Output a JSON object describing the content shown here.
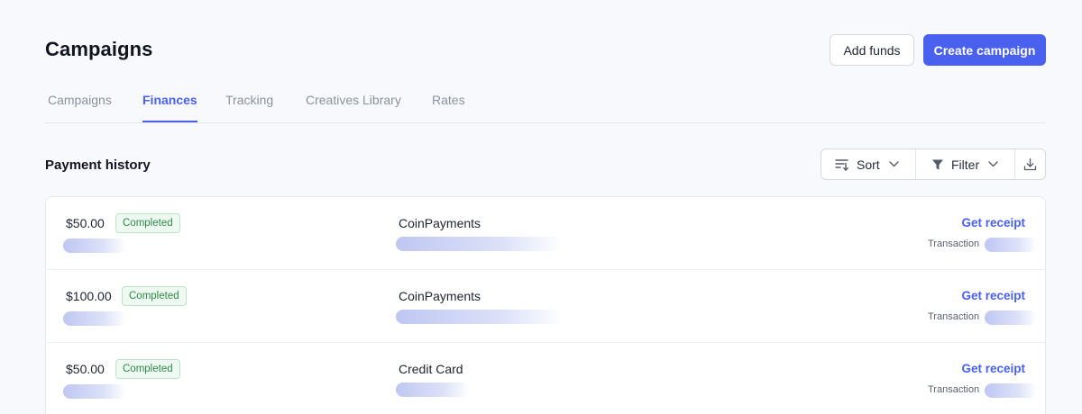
{
  "header": {
    "title": "Campaigns",
    "add_funds_label": "Add funds",
    "create_campaign_label": "Create campaign"
  },
  "tabs": [
    {
      "label": "Campaigns",
      "active": false
    },
    {
      "label": "Finances",
      "active": true
    },
    {
      "label": "Tracking",
      "active": false
    },
    {
      "label": "Creatives Library",
      "active": false
    },
    {
      "label": "Rates",
      "active": false
    }
  ],
  "section": {
    "title": "Payment history",
    "sort_label": "Sort",
    "filter_label": "Filter",
    "icons": {
      "sort": "sort-icon",
      "filter": "filter-icon",
      "download": "download-icon",
      "chevron": "chevron-down-icon"
    }
  },
  "payments": [
    {
      "amount": "$50.00",
      "status": "Completed",
      "method": "CoinPayments",
      "receipt_label": "Get receipt",
      "transaction_label": "Transaction"
    },
    {
      "amount": "$100.00",
      "status": "Completed",
      "method": "CoinPayments",
      "receipt_label": "Get receipt",
      "transaction_label": "Transaction"
    },
    {
      "amount": "$50.00",
      "status": "Completed",
      "method": "Credit Card",
      "receipt_label": "Get receipt",
      "transaction_label": "Transaction"
    }
  ],
  "colors": {
    "accent": "#4961ee",
    "success_text": "#2f8a48",
    "success_bg": "#eefaf1",
    "background": "#f8f9fc"
  }
}
